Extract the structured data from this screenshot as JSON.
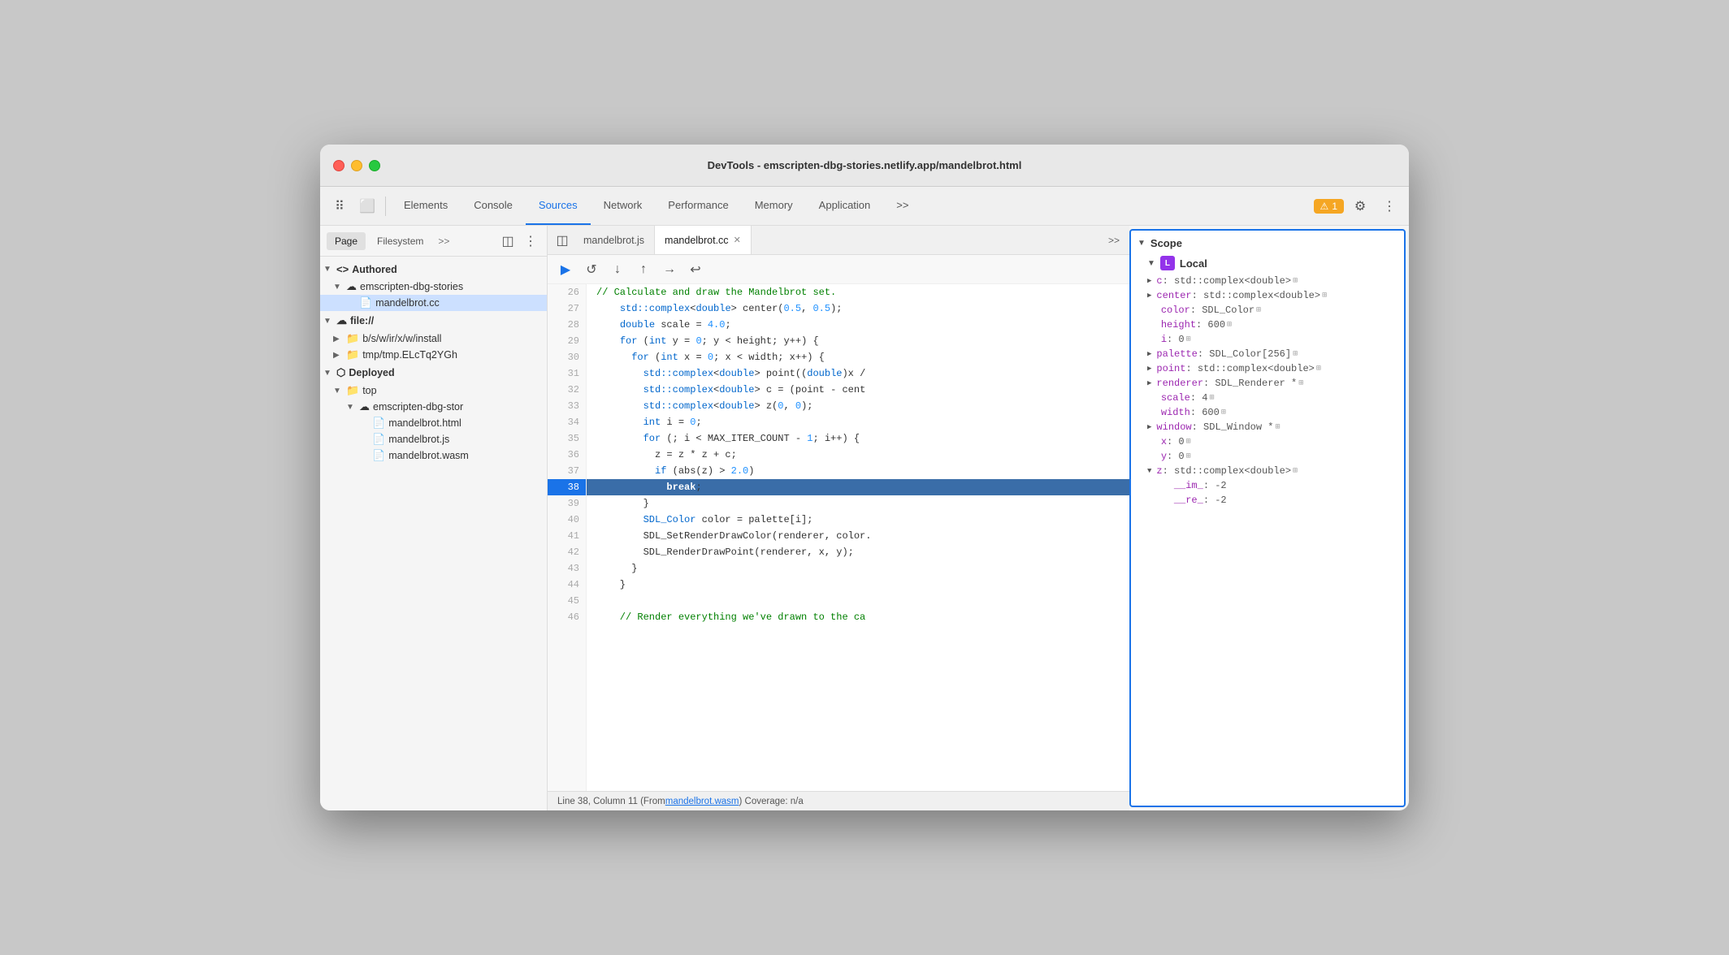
{
  "window": {
    "title": "DevTools - emscripten-dbg-stories.netlify.app/mandelbrot.html"
  },
  "toolbar": {
    "tabs": [
      {
        "id": "elements",
        "label": "Elements",
        "active": false
      },
      {
        "id": "console",
        "label": "Console",
        "active": false
      },
      {
        "id": "sources",
        "label": "Sources",
        "active": true
      },
      {
        "id": "network",
        "label": "Network",
        "active": false
      },
      {
        "id": "performance",
        "label": "Performance",
        "active": false
      },
      {
        "id": "memory",
        "label": "Memory",
        "active": false
      },
      {
        "id": "application",
        "label": "Application",
        "active": false
      }
    ],
    "warning_count": "1",
    "more_label": ">>"
  },
  "sidebar": {
    "tabs": [
      {
        "id": "page",
        "label": "Page",
        "active": true
      },
      {
        "id": "filesystem",
        "label": "Filesystem",
        "active": false
      }
    ],
    "tree": {
      "authored_label": "Authored",
      "authored_items": [
        {
          "label": "emscripten-dbg-stories",
          "type": "cloud",
          "indent": 1
        },
        {
          "label": "mandelbrot.cc",
          "type": "file-orange",
          "indent": 2,
          "selected": true
        }
      ],
      "file_label": "file://",
      "file_items": [
        {
          "label": "b/s/w/ir/x/w/install",
          "type": "folder",
          "indent": 2
        },
        {
          "label": "tmp/tmp.ELcTq2YGh",
          "type": "folder",
          "indent": 2
        }
      ],
      "deployed_label": "Deployed",
      "deployed_items": [
        {
          "label": "top",
          "type": "folder",
          "indent": 1
        },
        {
          "label": "emscripten-dbg-stor",
          "type": "cloud",
          "indent": 2
        },
        {
          "label": "mandelbrot.html",
          "type": "file-white",
          "indent": 3
        },
        {
          "label": "mandelbrot.js",
          "type": "file-orange",
          "indent": 3
        },
        {
          "label": "mandelbrot.wasm",
          "type": "file-orange",
          "indent": 3
        }
      ]
    }
  },
  "editor": {
    "tabs": [
      {
        "id": "mandelbrot-js",
        "label": "mandelbrot.js",
        "active": false,
        "closable": false
      },
      {
        "id": "mandelbrot-cc",
        "label": "mandelbrot.cc",
        "active": true,
        "closable": true
      }
    ],
    "lines": [
      {
        "num": 26,
        "code": "    // Calculate and draw the Mandelbrot set.",
        "type": "comment"
      },
      {
        "num": 27,
        "code": "    std::complex<double> center(0.5, 0.5);",
        "type": "normal"
      },
      {
        "num": 28,
        "code": "    double scale = 4.0;",
        "type": "normal"
      },
      {
        "num": 29,
        "code": "    for (int y = 0; y < height; y++) {",
        "type": "for"
      },
      {
        "num": 30,
        "code": "      for (int x = 0; x < width; x++) {",
        "type": "for"
      },
      {
        "num": 31,
        "code": "        std::complex<double> point((double)x /",
        "type": "normal"
      },
      {
        "num": 32,
        "code": "        std::complex<double> c = (point - cent",
        "type": "normal"
      },
      {
        "num": 33,
        "code": "        std::complex<double> z(0, 0);",
        "type": "normal"
      },
      {
        "num": 34,
        "code": "        int i = 0;",
        "type": "normal"
      },
      {
        "num": 35,
        "code": "        for (; i < MAX_ITER_COUNT - 1; i++) {",
        "type": "for"
      },
      {
        "num": 36,
        "code": "          z = z * z + c;",
        "type": "normal"
      },
      {
        "num": 37,
        "code": "          if (abs(z) > 2.0)",
        "type": "normal"
      },
      {
        "num": 38,
        "code": "            break;",
        "type": "breakpoint",
        "highlight": true
      },
      {
        "num": 39,
        "code": "        }",
        "type": "normal"
      },
      {
        "num": 40,
        "code": "        SDL_Color color = palette[i];",
        "type": "normal"
      },
      {
        "num": 41,
        "code": "        SDL_SetRenderDrawColor(renderer, color.",
        "type": "normal"
      },
      {
        "num": 42,
        "code": "        SDL_RenderDrawPoint(renderer, x, y);",
        "type": "normal"
      },
      {
        "num": 43,
        "code": "      }",
        "type": "normal"
      },
      {
        "num": 44,
        "code": "    }",
        "type": "normal"
      },
      {
        "num": 45,
        "code": "",
        "type": "normal"
      },
      {
        "num": 46,
        "code": "    // Render everything we've drawn to the ca",
        "type": "comment"
      }
    ],
    "statusbar": {
      "text": "Line 38, Column 11 (From ",
      "link_text": "mandelbrot.wasm",
      "text2": ") Coverage: n/a"
    }
  },
  "scope": {
    "header": "Scope",
    "local_label": "Local",
    "items": [
      {
        "name": "c",
        "value": "std::complex<double>",
        "expandable": true
      },
      {
        "name": "center",
        "value": "std::complex<double>",
        "expandable": true
      },
      {
        "name": "color",
        "value": "SDL_Color",
        "expandable": false
      },
      {
        "name": "height",
        "value": "600",
        "expandable": false
      },
      {
        "name": "i",
        "value": "0",
        "expandable": false
      },
      {
        "name": "palette",
        "value": "SDL_Color[256]",
        "expandable": true
      },
      {
        "name": "point",
        "value": "std::complex<double>",
        "expandable": true
      },
      {
        "name": "renderer",
        "value": "SDL_Renderer *",
        "expandable": true
      },
      {
        "name": "scale",
        "value": "4",
        "expandable": false
      },
      {
        "name": "width",
        "value": "600",
        "expandable": false
      },
      {
        "name": "window",
        "value": "SDL_Window *",
        "expandable": true
      },
      {
        "name": "x",
        "value": "0",
        "expandable": false
      },
      {
        "name": "y",
        "value": "0",
        "expandable": false
      },
      {
        "name": "z",
        "value": "std::complex<double>",
        "expandable": true,
        "expanded": true
      },
      {
        "name": "__im_",
        "value": "-2",
        "sub": true
      },
      {
        "name": "__re_",
        "value": "-2",
        "sub": true
      }
    ]
  }
}
